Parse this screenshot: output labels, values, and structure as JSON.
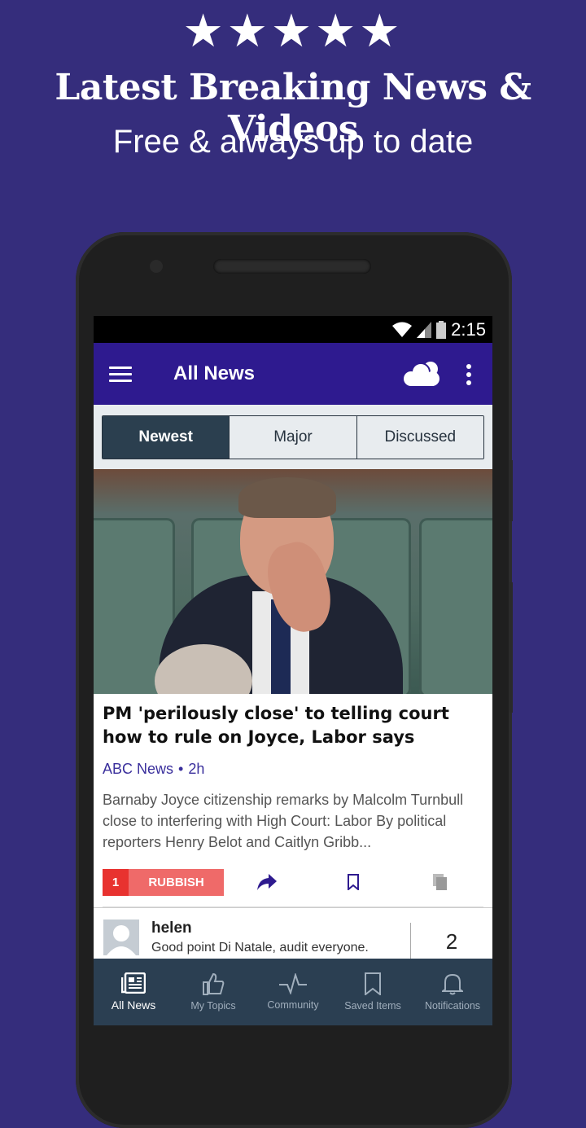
{
  "promo": {
    "stars": "★★★★★",
    "rating_stars": 5,
    "headline": "Latest Breaking News & Videos",
    "subheadline": "Free & always up to date"
  },
  "status_bar": {
    "time": "2:15",
    "icons": [
      "wifi-icon",
      "signal-icon",
      "battery-icon"
    ]
  },
  "app_bar": {
    "title": "All News",
    "icons": [
      "menu-icon",
      "weather-cloud-icon",
      "more-vert-icon"
    ]
  },
  "segments": [
    {
      "label": "Newest",
      "selected": true
    },
    {
      "label": "Major",
      "selected": false
    },
    {
      "label": "Discussed",
      "selected": false
    }
  ],
  "article": {
    "headline": "PM 'perilously close' to telling court how to rule on Joyce, Labor says",
    "source": "ABC News",
    "separator": "•",
    "age": "2h",
    "summary": "Barnaby Joyce citizenship remarks by Malcolm Turnbull close to interfering with High Court: Labor By political reporters Henry Belot and Caitlyn Gribb...",
    "rubbish_count": "1",
    "rubbish_label": "RUBBISH",
    "colors": {
      "accent": "#2e1a8f",
      "rubbish_dark": "#e8322f",
      "rubbish_light": "#ef6a69",
      "source": "#3a2f9c"
    }
  },
  "comment": {
    "user": "helen",
    "text": "Good point Di Natale, audit everyone.",
    "count": "2"
  },
  "bottom_nav": [
    {
      "label": "All News",
      "icon": "newspaper-icon",
      "active": true
    },
    {
      "label": "My Topics",
      "icon": "thumbs-up-icon",
      "active": false
    },
    {
      "label": "Community",
      "icon": "pulse-icon",
      "active": false
    },
    {
      "label": "Saved Items",
      "icon": "bookmark-icon",
      "active": false
    },
    {
      "label": "Notifications",
      "icon": "bell-icon",
      "active": false
    }
  ]
}
